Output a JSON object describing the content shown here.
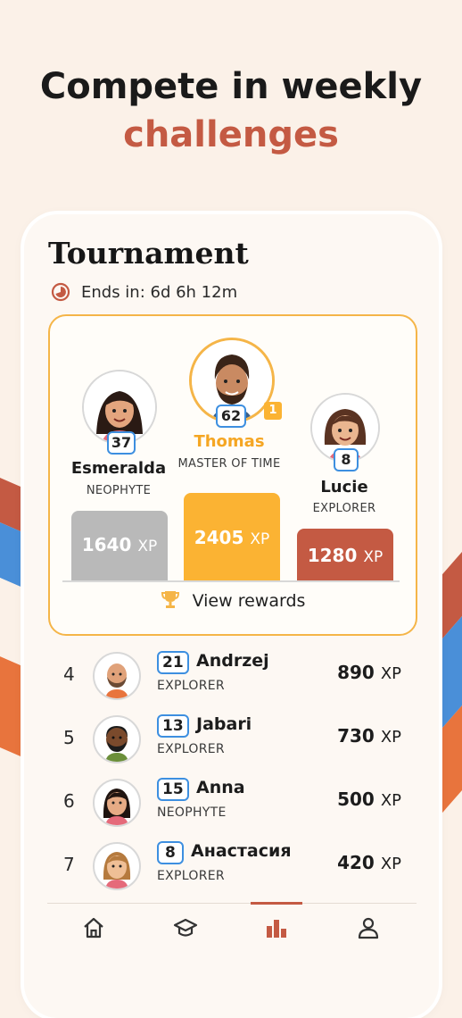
{
  "headline": {
    "line1": "Compete in weekly",
    "line2": "challenges"
  },
  "colors": {
    "accent": "#c45a43",
    "gold": "#f5b548",
    "badge_border": "#3d8fe0",
    "first_bar": "#fbb333",
    "second_bar": "#b9b9b9",
    "third_bar": "#c45a43"
  },
  "tournament": {
    "title": "Tournament",
    "ends_label": "Ends in: 6d 6h 12m",
    "clock_icon": "clock-icon",
    "podium": {
      "first": {
        "name": "Thomas",
        "level": "62",
        "rank": "MASTER OF TIME",
        "xp": "2405",
        "unit": "XP",
        "place": "1"
      },
      "second": {
        "name": "Esmeralda",
        "level": "37",
        "rank": "NEOPHYTE",
        "xp": "1640",
        "unit": "XP"
      },
      "third": {
        "name": "Lucie",
        "level": "8",
        "rank": "EXPLORER",
        "xp": "1280",
        "unit": "XP"
      }
    },
    "view_rewards": "View rewards",
    "trophy_icon": "trophy-icon"
  },
  "leaderboard": [
    {
      "position": "4",
      "level": "21",
      "name": "Andrzej",
      "rank": "EXPLORER",
      "xp": "890",
      "unit": "XP"
    },
    {
      "position": "5",
      "level": "13",
      "name": "Jabari",
      "rank": "EXPLORER",
      "xp": "730",
      "unit": "XP"
    },
    {
      "position": "6",
      "level": "15",
      "name": "Anna",
      "rank": "NEOPHYTE",
      "xp": "500",
      "unit": "XP"
    },
    {
      "position": "7",
      "level": "8",
      "name": "Анастасия",
      "rank": "EXPLORER",
      "xp": "420",
      "unit": "XP"
    }
  ],
  "bottom_nav": [
    {
      "icon": "home-icon",
      "active": false
    },
    {
      "icon": "graduation-cap-icon",
      "active": false
    },
    {
      "icon": "leaderboard-icon",
      "active": true
    },
    {
      "icon": "profile-icon",
      "active": false
    }
  ]
}
